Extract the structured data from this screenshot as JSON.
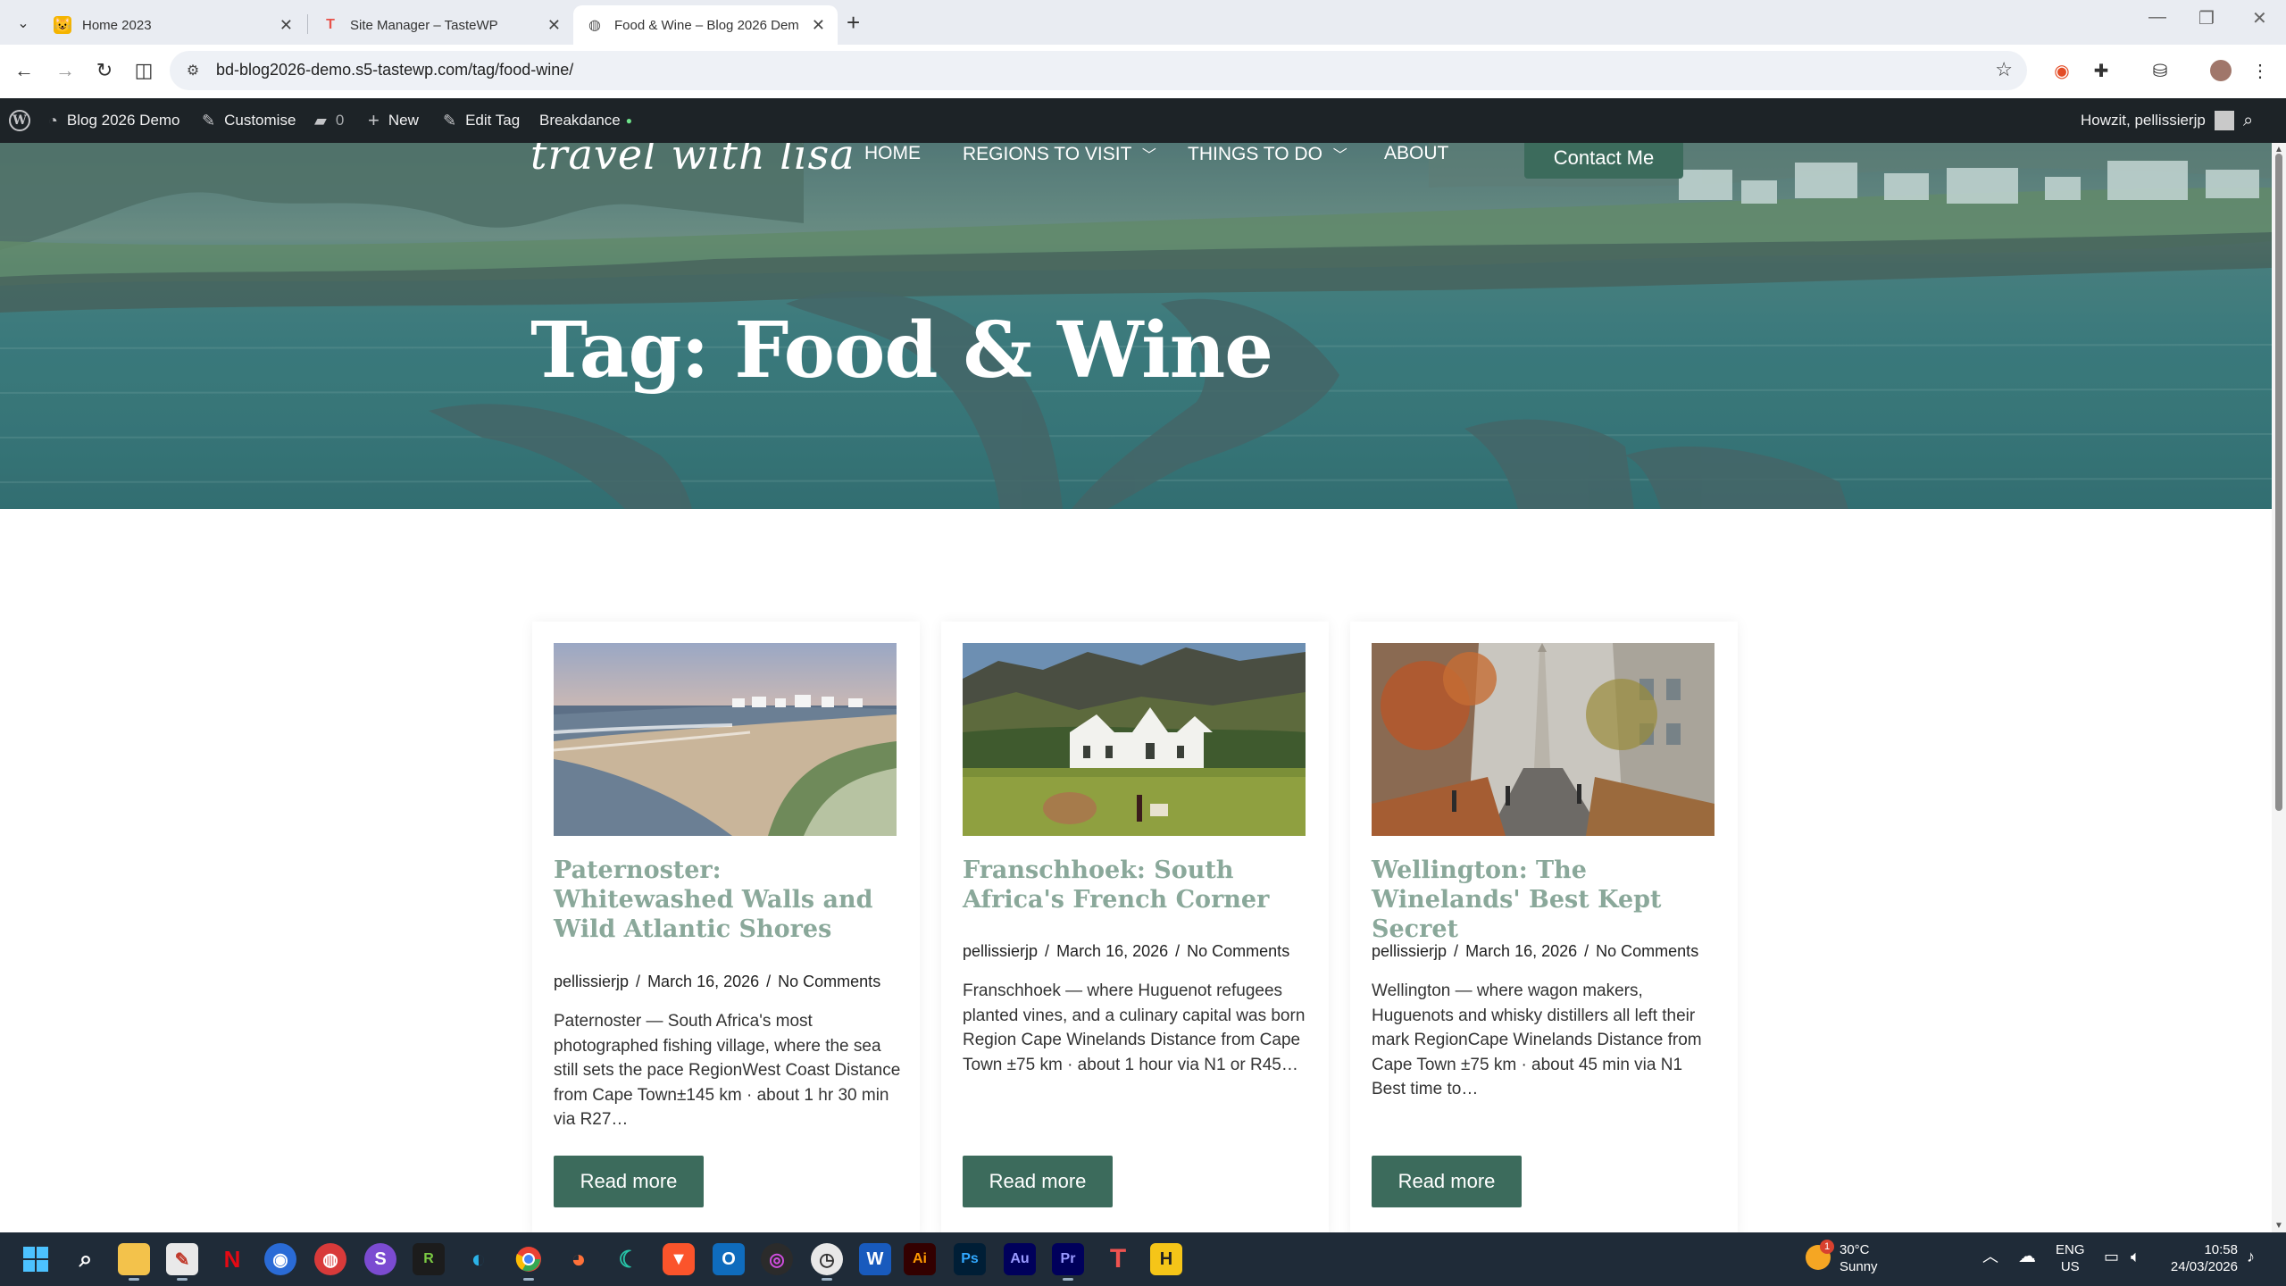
{
  "browser": {
    "tabs": [
      {
        "title": "Home 2023",
        "icon": "emoji-face-icon",
        "active": false
      },
      {
        "title": "Site Manager – TasteWP",
        "icon": "tastewp-icon",
        "active": false
      },
      {
        "title": "Food & Wine – Blog 2026 Dem",
        "icon": "globe-icon",
        "active": true
      }
    ],
    "url": "bd-blog2026-demo.s5-tastewp.com/tag/food-wine/"
  },
  "admin_bar": {
    "site_name": "Blog 2026 Demo",
    "customise": "Customise",
    "comments_count": "0",
    "new": "New",
    "edit_tag": "Edit Tag",
    "breakdance": "Breakdance",
    "greeting": "Howzit, pellissierjp"
  },
  "header": {
    "logo": "travel with lisa",
    "nav": [
      {
        "label": "HOME"
      },
      {
        "label": "REGIONS TO VISIT"
      },
      {
        "label": "THINGS TO DO"
      },
      {
        "label": "ABOUT"
      }
    ],
    "contact_button": "Contact Me",
    "page_title": "Tag: Food & Wine"
  },
  "posts": [
    {
      "title": "Paternoster: Whitewashed Walls and Wild Atlantic Shores",
      "author": "pellissierjp",
      "date": "March 16, 2026",
      "comments": "No Comments",
      "excerpt": "Paternoster — South Africa's most photographed fishing village, where the sea still sets the pace RegionWest Coast Distance from Cape Town±145 km · about 1 hr 30 min via R27…",
      "read_more": "Read more"
    },
    {
      "title": "Franschhoek: South Africa's French Corner",
      "author": "pellissierjp",
      "date": "March 16, 2026",
      "comments": "No Comments",
      "excerpt": "Franschhoek — where Huguenot refugees planted vines, and a culinary capital was born Region Cape Winelands Distance from Cape Town ±75 km · about 1 hour via N1 or R45…",
      "read_more": "Read more"
    },
    {
      "title": "Wellington: The Winelands' Best Kept Secret",
      "author": "pellissierjp",
      "date": "March 16, 2026",
      "comments": "No Comments",
      "excerpt": "Wellington — where wagon makers, Huguenots and whisky distillers all left their mark RegionCape Winelands Distance from Cape Town ±75 km · about 45 min via N1 Best time to…",
      "read_more": "Read more"
    }
  ],
  "taskbar": {
    "weather_temp": "30°C",
    "weather_desc": "Sunny",
    "weather_badge": "1",
    "lang_top": "ENG",
    "lang_bottom": "US",
    "time": "10:58",
    "date": "24/03/2026",
    "apps": [
      "start-icon",
      "search-icon",
      "file-explorer-icon",
      "notepad-icon",
      "netflix-icon",
      "app-blue-icon",
      "app-red-icon",
      "app-purple-s-icon",
      "app-rstudio-icon",
      "edge-icon",
      "chrome-icon",
      "firefox-icon",
      "app-teal-icon",
      "brave-icon",
      "outlook-icon",
      "app-dark-icon",
      "app-clock-icon",
      "word-icon",
      "illustrator-icon",
      "photoshop-icon",
      "audition-icon",
      "premiere-icon",
      "tastewp-icon",
      "app-yellow-icon"
    ]
  },
  "colors": {
    "accent": "#3c6b5c",
    "title_green": "#8aa89a",
    "admin_bar": "#1d2327",
    "taskbar": "#1f2b38"
  }
}
